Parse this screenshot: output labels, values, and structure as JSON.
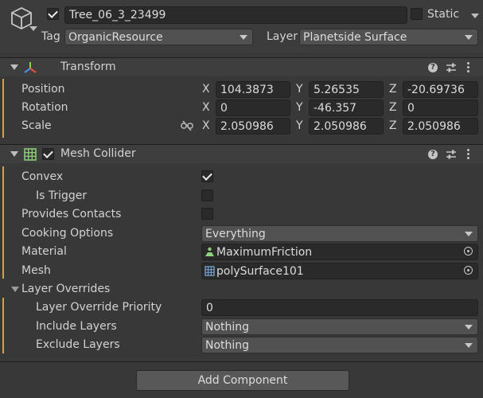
{
  "header": {
    "object_name": "Tree_06_3_23499",
    "active": true,
    "static_label": "Static",
    "static_checked": false,
    "tag_label": "Tag",
    "tag_value": "OrganicResource",
    "layer_label": "Layer",
    "layer_value": "Planetside Surface",
    "icon": "gameobject-cube-icon"
  },
  "transform": {
    "title": "Transform",
    "icon": "transform-axes-icon",
    "rows": [
      {
        "label": "Position",
        "x": "104.3873",
        "y": "5.26535",
        "z": "-20.69736"
      },
      {
        "label": "Rotation",
        "x": "0",
        "y": "-46.357",
        "z": "0"
      },
      {
        "label": "Scale",
        "x": "2.050986",
        "y": "2.050986",
        "z": "2.050986"
      }
    ],
    "axis_labels": {
      "x": "X",
      "y": "Y",
      "z": "Z"
    },
    "scale_link_icon": "unlinked-chain-icon"
  },
  "mesh_collider": {
    "title": "Mesh Collider",
    "enabled": true,
    "icon": "mesh-collider-grid-icon",
    "convex_label": "Convex",
    "convex": true,
    "is_trigger_label": "Is Trigger",
    "is_trigger": false,
    "provides_contacts_label": "Provides Contacts",
    "provides_contacts": false,
    "cooking_options_label": "Cooking Options",
    "cooking_options_value": "Everything",
    "material_label": "Material",
    "material_value": "MaximumFriction",
    "material_icon": "physic-material-icon",
    "mesh_label": "Mesh",
    "mesh_value": "polySurface101",
    "mesh_icon": "mesh-grid-icon",
    "layer_overrides_label": "Layer Overrides",
    "layer_override_priority_label": "Layer Override Priority",
    "layer_override_priority_value": "0",
    "include_layers_label": "Include Layers",
    "include_layers_value": "Nothing",
    "exclude_layers_label": "Exclude Layers",
    "exclude_layers_value": "Nothing"
  },
  "footer": {
    "add_component_label": "Add Component"
  },
  "colors": {
    "background": "#383838",
    "field": "#2a2a2a",
    "accent_modified": "#d7a23c",
    "mesh_collider_icon": "#8ed17a"
  }
}
